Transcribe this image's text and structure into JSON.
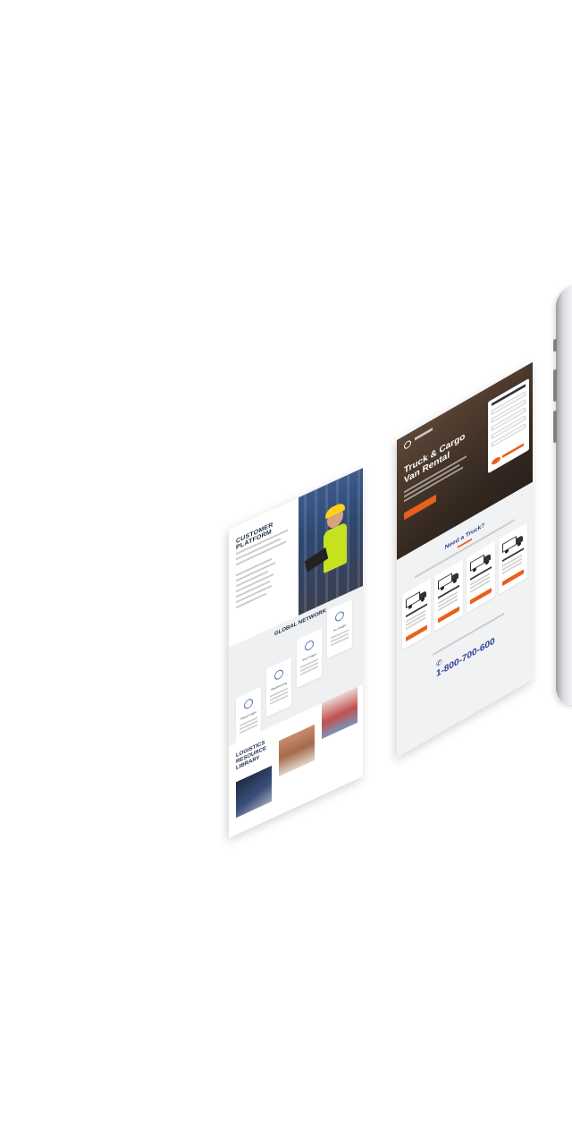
{
  "left_page": {
    "hero_title": "CUSTOMER PLATFORM",
    "network_title": "GLOBAL NETWORK",
    "network_cards": [
      "Road Freight",
      "Warehousing",
      "Sea Freight",
      "Air Freight"
    ],
    "library_title": "LOGISTICS RESOURCE LIBRARY"
  },
  "right_page": {
    "hero_title": "Truck & Cargo Van Rental",
    "need_title": "Need a Truck?",
    "trucks": [
      "Cargo Van",
      "12 Foot Truck",
      "16 Foot Truck",
      "20 Foot Truck"
    ],
    "phone_number": "1-800-700-600"
  },
  "colors": {
    "accent_orange": "#e8601c",
    "brand_navy": "#2b3d8f",
    "heading_dark": "#1c2a44",
    "vest_yellow": "#c6e21e"
  }
}
